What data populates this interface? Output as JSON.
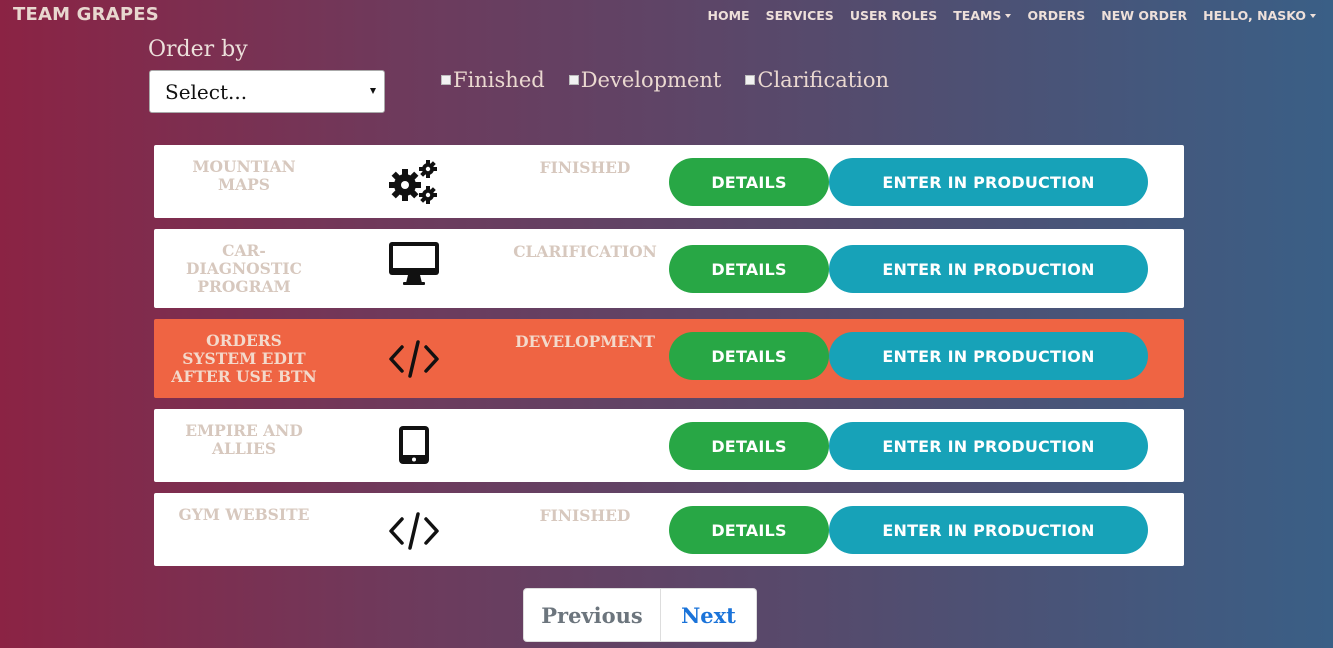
{
  "navbar": {
    "brand": "TEAM GRAPES",
    "links": {
      "home": "HOME",
      "services": "SERVICES",
      "user_roles": "USER ROLES",
      "teams": "TEAMS",
      "orders": "ORDERS",
      "new_order": "NEW ORDER",
      "user": "HELLO, NASKO"
    }
  },
  "filters": {
    "order_by_label": "Order by",
    "select_value": "Select...",
    "checkboxes": {
      "finished": "Finished",
      "development": "Development",
      "clarification": "Clarification"
    }
  },
  "orders": [
    {
      "name": "MOUNTIAN\nMAPS",
      "icon": "gears-icon",
      "status": "FINISHED"
    },
    {
      "name": "CAR-\nDIAGNOSTIC\nPROGRAM",
      "icon": "desktop-icon",
      "status": "CLARIFICATION"
    },
    {
      "name": "ORDERS\nSYSTEM EDIT\nAFTER USE BTN",
      "icon": "code-icon",
      "status": "DEVELOPMENT"
    },
    {
      "name": "EMPIRE AND\nALLIES",
      "icon": "tablet-icon",
      "status": ""
    },
    {
      "name": "GYM WEBSITE",
      "icon": "code-icon",
      "status": "FINISHED"
    }
  ],
  "buttons": {
    "details": "DETAILS",
    "enter_production": "ENTER IN PRODUCTION"
  },
  "pagination": {
    "previous": "Previous",
    "next": "Next"
  },
  "colors": {
    "details": "#28a745",
    "production": "#17a2b8",
    "highlight_row": "#ef6443"
  }
}
